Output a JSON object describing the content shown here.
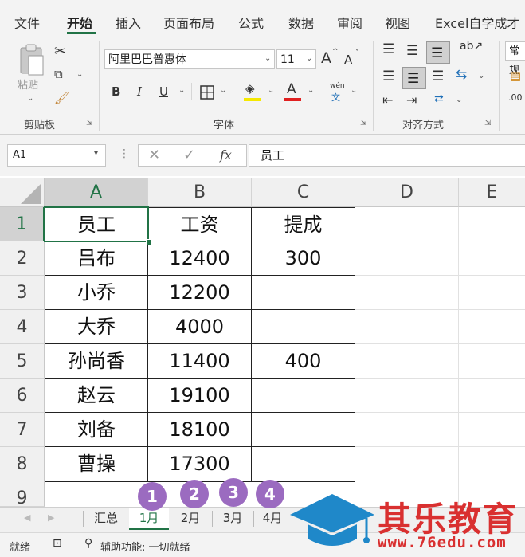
{
  "ribbon_tabs": [
    "文件",
    "开始",
    "插入",
    "页面布局",
    "公式",
    "数据",
    "审阅",
    "视图",
    "Excel自学成才"
  ],
  "active_tab": "开始",
  "clipboard": {
    "paste_label": "粘贴",
    "group_label": "剪贴板"
  },
  "font": {
    "name": "阿里巴巴普惠体",
    "size": "11",
    "group_label": "字体",
    "bold": "B",
    "italic": "I",
    "underline": "U",
    "grow": "A",
    "shrink": "A",
    "font_color": "A",
    "phonetic_top": "wén",
    "phonetic_bottom": "文",
    "font_color_hex": "#e02020",
    "fill_color_hex": "#f5e800"
  },
  "alignment": {
    "group_label": "对齐方式"
  },
  "number": {
    "format_label": "常规"
  },
  "formula_bar": {
    "name_box": "A1",
    "fx": "fx",
    "content": "员工"
  },
  "columns": [
    "A",
    "B",
    "C",
    "D",
    "E"
  ],
  "rows": [
    "1",
    "2",
    "3",
    "4",
    "5",
    "6",
    "7",
    "8",
    "9"
  ],
  "cells": [
    [
      "员工",
      "工资",
      "提成"
    ],
    [
      "吕布",
      "12400",
      "300"
    ],
    [
      "小乔",
      "12200",
      ""
    ],
    [
      "大乔",
      "4000",
      ""
    ],
    [
      "孙尚香",
      "11400",
      "400"
    ],
    [
      "赵云",
      "19100",
      ""
    ],
    [
      "刘备",
      "18100",
      ""
    ],
    [
      "曹操",
      "17300",
      ""
    ]
  ],
  "sheet_tabs": [
    "汇总",
    "1月",
    "2月",
    "3月",
    "4月"
  ],
  "active_sheet": "1月",
  "badges": [
    "1",
    "2",
    "3",
    "4"
  ],
  "status": {
    "ready": "就绪",
    "accessibility": "辅助功能: 一切就绪"
  },
  "logo": {
    "name": "其乐教育",
    "url": "www.76edu.com"
  },
  "colors": {
    "accent": "#217346",
    "badge": "#9b6bc0",
    "logo": "#d93030",
    "logo_blue": "#1f88c9"
  }
}
